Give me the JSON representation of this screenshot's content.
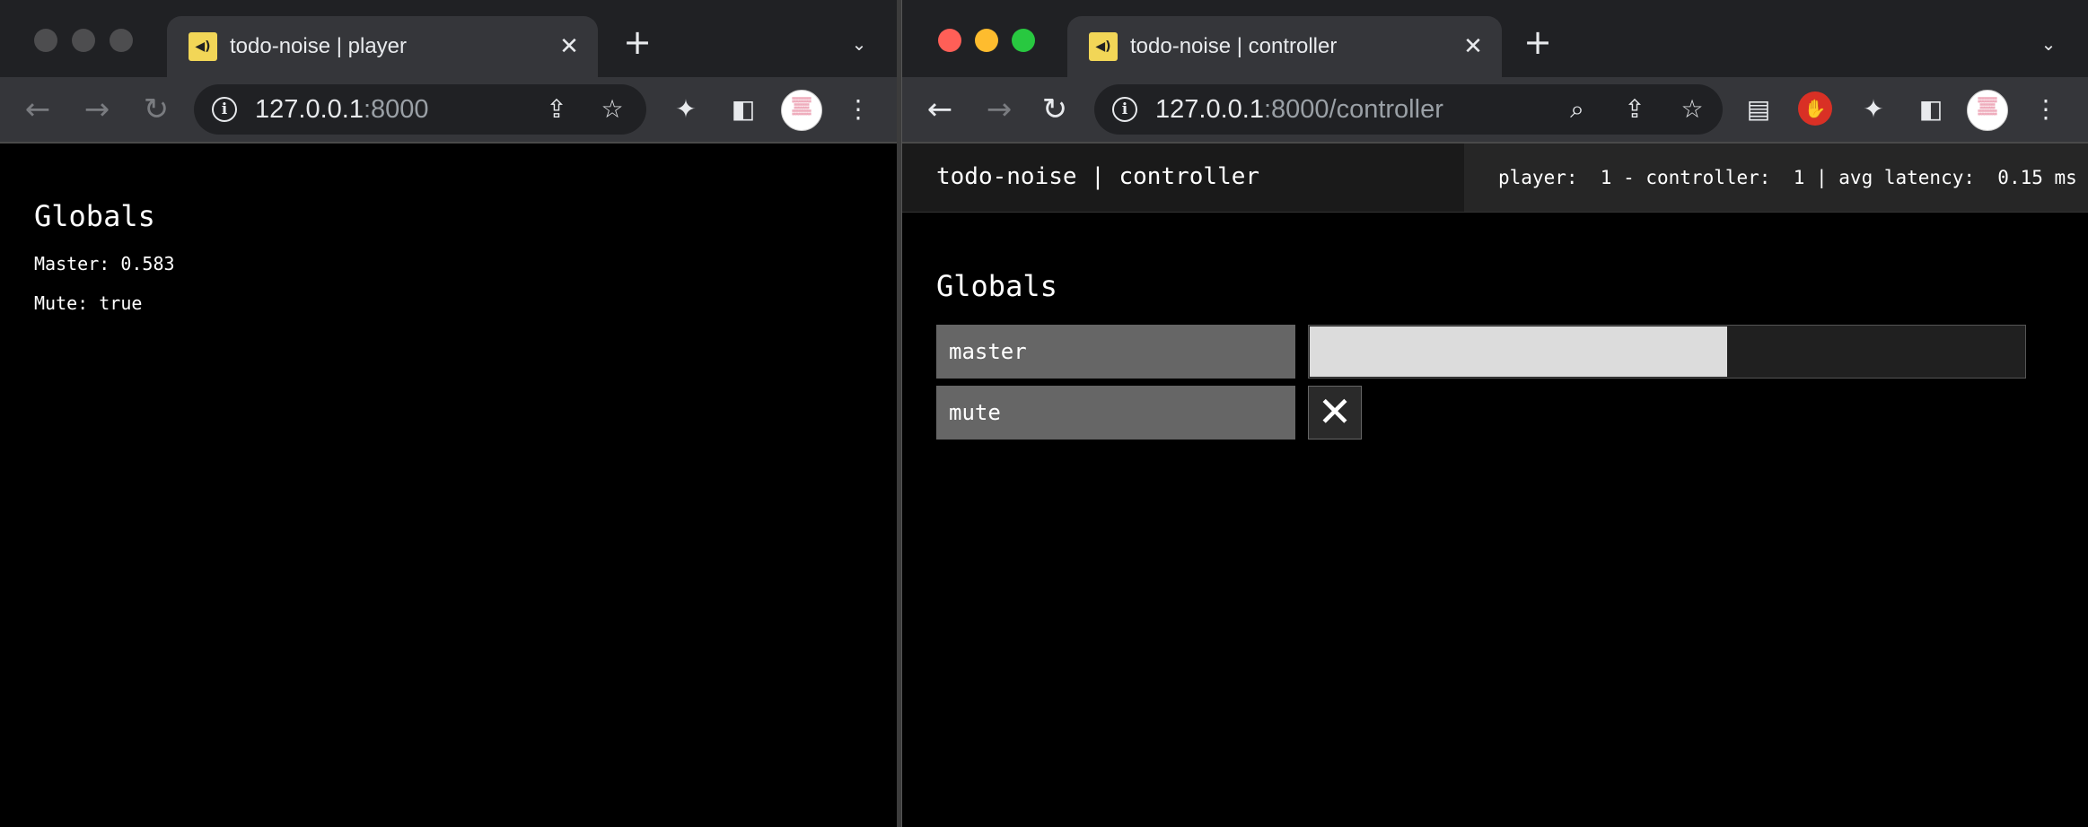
{
  "left_window": {
    "tab": {
      "favicon": "speaker-icon",
      "title": "todo-noise | player"
    },
    "url": {
      "host": "127.0.0.1",
      "rest": ":8000"
    },
    "page": {
      "heading": "Globals",
      "lines": [
        "Master: 0.583",
        "Mute: true"
      ]
    }
  },
  "right_window": {
    "tab": {
      "favicon": "speaker-icon",
      "title": "todo-noise | controller"
    },
    "url": {
      "host": "127.0.0.1",
      "rest": ":8000/controller"
    },
    "page": {
      "header_title": "todo-noise | controller",
      "status": "player:  1 - controller:  1 | avg latency:  0.15 ms",
      "heading": "Globals",
      "params": [
        {
          "label": "master",
          "type": "slider",
          "value": 0.583
        },
        {
          "label": "mute",
          "type": "toggle",
          "value": true,
          "symbol": "✕"
        }
      ]
    }
  },
  "icons": {
    "back": "←",
    "forward": "→",
    "reload": "↻",
    "info": "i",
    "share": "⇪",
    "star": "☆",
    "puzzle": "✦",
    "sidepanel": "◧",
    "menu": "⋮",
    "search": "⌕",
    "close": "✕",
    "plus": "+",
    "chevron": "⌄",
    "doc": "▤",
    "hand": "✋"
  },
  "colors": {
    "traffic_red": "#ff5f57",
    "traffic_yellow": "#febc2e",
    "traffic_green": "#28c840",
    "traffic_inactive": "#4d4d4f",
    "favicon": "#f2d657"
  }
}
